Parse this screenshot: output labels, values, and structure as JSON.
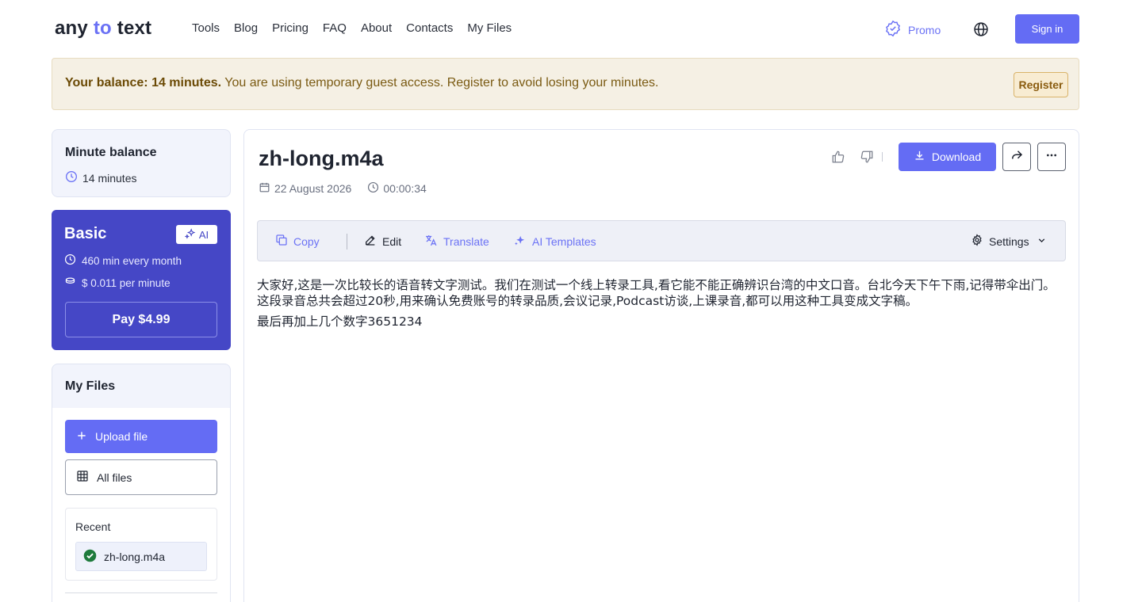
{
  "header": {
    "logo": {
      "part1": "any ",
      "part2": "to",
      "part3": " text"
    },
    "nav": [
      "Tools",
      "Blog",
      "Pricing",
      "FAQ",
      "About",
      "Contacts",
      "My Files"
    ],
    "promo_label": "Promo",
    "language_icon": "globe-icon",
    "signin_label": "Sign in"
  },
  "banner": {
    "balance_label": "Your balance: 14 minutes.",
    "message": " You are using temporary guest access. Register to avoid losing your minutes.",
    "register_label": "Register"
  },
  "sidebar": {
    "balance_card": {
      "title": "Minute balance",
      "minutes": "14 minutes"
    },
    "plan_card": {
      "title": "Basic",
      "ai_badge": "AI",
      "monthly": "460 min every month",
      "price_per_minute": "$ 0.011 per minute",
      "pay_label": "Pay  $4.99"
    },
    "files_card": {
      "title": "My Files",
      "upload_label": "Upload file",
      "all_files_label": "All files",
      "recent_label": "Recent",
      "recent_items": [
        {
          "name": "zh-long.m4a",
          "status": "done"
        }
      ]
    }
  },
  "main": {
    "file_name": "zh-long.m4a",
    "date": "22 August 2026",
    "duration": "00:00:34",
    "download_label": "Download",
    "toolbar": {
      "copy": "Copy",
      "edit": "Edit",
      "translate": "Translate",
      "ai_templates": "AI Templates",
      "settings": "Settings"
    },
    "transcript": [
      "大家好,这是一次比较长的语音转文字测试。我们在测试一个线上转录工具,看它能不能正确辨识台湾的中文口音。台北今天下午下雨,记得带伞出门。这段录音总共会超过20秒,用来确认免费账号的转录品质,会议记录,Podcast访谈,上课录音,都可以用这种工具变成文字稿。",
      "最后再加上几个数字3651234"
    ]
  },
  "colors": {
    "accent": "#646cf4",
    "plan_bg": "#4547c6",
    "banner_bg": "#f5f0e4",
    "success": "#1e7a3c"
  }
}
